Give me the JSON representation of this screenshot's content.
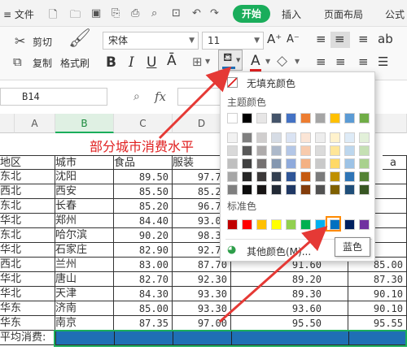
{
  "titlebar": {
    "menu": "≡ 文件",
    "start": "开始",
    "insert": "插入",
    "layout": "页面布局",
    "formula": "公式"
  },
  "ribbon": {
    "cut": "剪切",
    "copy": "复制",
    "format_painter": "格式刷",
    "font_name": "宋体",
    "font_size": "11",
    "bold": "B",
    "italic": "I",
    "underline": "U",
    "font_a": "A"
  },
  "formula": {
    "cell_ref": "B14",
    "fx": "fx"
  },
  "columns": [
    "A",
    "B",
    "C",
    "D"
  ],
  "sheet": {
    "title": "部分城市消费水平",
    "headers": [
      "地区",
      "城市",
      "食品",
      "服装"
    ],
    "rows": [
      {
        "region": "东北",
        "city": "沈阳",
        "food": "89.50",
        "cloth": "97.70",
        "e": "",
        "f": ""
      },
      {
        "region": "西北",
        "city": "西安",
        "food": "85.50",
        "cloth": "85.20",
        "e": "",
        "f": ""
      },
      {
        "region": "东北",
        "city": "长春",
        "food": "85.20",
        "cloth": "96.70",
        "e": "",
        "f": ""
      },
      {
        "region": "华北",
        "city": "郑州",
        "food": "84.40",
        "cloth": "93.00",
        "e": "",
        "f": ""
      },
      {
        "region": "东北",
        "city": "哈尔滨",
        "food": "90.20",
        "cloth": "98.30",
        "e": "",
        "f": ""
      },
      {
        "region": "华北",
        "city": "石家庄",
        "food": "82.90",
        "cloth": "92.70",
        "e": "",
        "f": ""
      },
      {
        "region": "西北",
        "city": "兰州",
        "food": "83.00",
        "cloth": "87.70",
        "e": "91.60",
        "f": "85.00"
      },
      {
        "region": "华北",
        "city": "唐山",
        "food": "82.70",
        "cloth": "92.30",
        "e": "89.20",
        "f": "87.30"
      },
      {
        "region": "华北",
        "city": "天津",
        "food": "84.30",
        "cloth": "93.30",
        "e": "89.30",
        "f": "90.10"
      },
      {
        "region": "华东",
        "city": "济南",
        "food": "85.00",
        "cloth": "93.30",
        "e": "93.60",
        "f": "90.10"
      },
      {
        "region": "华东",
        "city": "南京",
        "food": "87.35",
        "cloth": "97.00",
        "e": "95.50",
        "f": "95.55"
      }
    ],
    "avg_label": "平均消费:"
  },
  "popup": {
    "no_fill": "无填充颜色",
    "theme": "主题颜色",
    "standard": "标准色",
    "more": "其他颜色(M)...",
    "tooltip": "蓝色",
    "partial_label": "a"
  },
  "colors": {
    "title_red": "#e02020",
    "selection_blue": "#1f6fb5",
    "arrow_red": "#e53935",
    "accent_green": "#1aad5b"
  },
  "theme_top": [
    "#ffffff",
    "#000000",
    "#e7e6e6",
    "#44546a",
    "#4472c4",
    "#ed7d31",
    "#a5a5a5",
    "#ffc000",
    "#5b9bd5",
    "#70ad47"
  ],
  "theme_shades": [
    [
      "#f2f2f2",
      "#7f7f7f",
      "#d0cece",
      "#d6dce5",
      "#dae3f3",
      "#fbe5d6",
      "#ededed",
      "#fff2cc",
      "#deebf7",
      "#e2f0d9"
    ],
    [
      "#d9d9d9",
      "#595959",
      "#aeabab",
      "#adb9ca",
      "#b4c7e7",
      "#f8cbad",
      "#dbdbdb",
      "#ffe699",
      "#bdd7ee",
      "#c5e0b4"
    ],
    [
      "#bfbfbf",
      "#404040",
      "#757171",
      "#8497b0",
      "#8faadc",
      "#f4b183",
      "#c9c9c9",
      "#ffd966",
      "#9dc3e6",
      "#a9d18e"
    ],
    [
      "#a6a6a6",
      "#262626",
      "#3b3838",
      "#333f50",
      "#2f5597",
      "#c55a11",
      "#7b7b7b",
      "#bf9000",
      "#2e75b6",
      "#548235"
    ],
    [
      "#7f7f7f",
      "#0d0d0d",
      "#171515",
      "#222a35",
      "#1f3864",
      "#833c0b",
      "#525252",
      "#7f6000",
      "#1f4e79",
      "#375623"
    ]
  ],
  "standard_colors": [
    "#c00000",
    "#ff0000",
    "#ffc000",
    "#ffff00",
    "#92d050",
    "#00b050",
    "#00b0f0",
    "#0070c0",
    "#002060",
    "#7030a0"
  ]
}
